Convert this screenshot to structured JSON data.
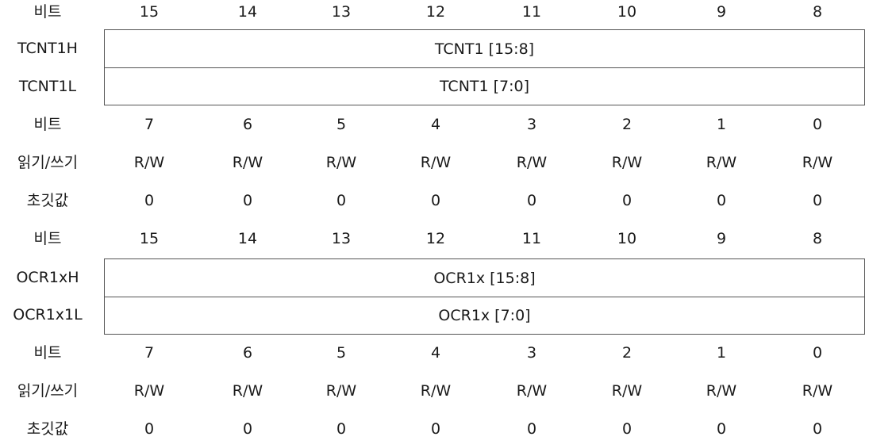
{
  "sections": [
    {
      "top_bits": {
        "label": "비트",
        "values": [
          "15",
          "14",
          "13",
          "12",
          "11",
          "10",
          "9",
          "8"
        ]
      },
      "register": {
        "high": {
          "label": "TCNT1H",
          "field": "TCNT1 [15:8]"
        },
        "low": {
          "label": "TCNT1L",
          "field": "TCNT1 [7:0]"
        }
      },
      "bottom_bits": {
        "label": "비트",
        "values": [
          "7",
          "6",
          "5",
          "4",
          "3",
          "2",
          "1",
          "0"
        ]
      },
      "rw": {
        "label": "읽기/쓰기",
        "values": [
          "R/W",
          "R/W",
          "R/W",
          "R/W",
          "R/W",
          "R/W",
          "R/W",
          "R/W"
        ]
      },
      "init": {
        "label": "초깃값",
        "values": [
          "0",
          "0",
          "0",
          "0",
          "0",
          "0",
          "0",
          "0"
        ]
      }
    },
    {
      "top_bits": {
        "label": "비트",
        "values": [
          "15",
          "14",
          "13",
          "12",
          "11",
          "10",
          "9",
          "8"
        ]
      },
      "register": {
        "high": {
          "label": "OCR1xH",
          "field": "OCR1x [15:8]"
        },
        "low": {
          "label": "OCR1x1L",
          "field": "OCR1x [7:0]"
        }
      },
      "bottom_bits": {
        "label": "비트",
        "values": [
          "7",
          "6",
          "5",
          "4",
          "3",
          "2",
          "1",
          "0"
        ]
      },
      "rw": {
        "label": "읽기/쓰기",
        "values": [
          "R/W",
          "R/W",
          "R/W",
          "R/W",
          "R/W",
          "R/W",
          "R/W",
          "R/W"
        ]
      },
      "init": {
        "label": "초깃값",
        "values": [
          "0",
          "0",
          "0",
          "0",
          "0",
          "0",
          "0",
          "0"
        ]
      }
    }
  ]
}
